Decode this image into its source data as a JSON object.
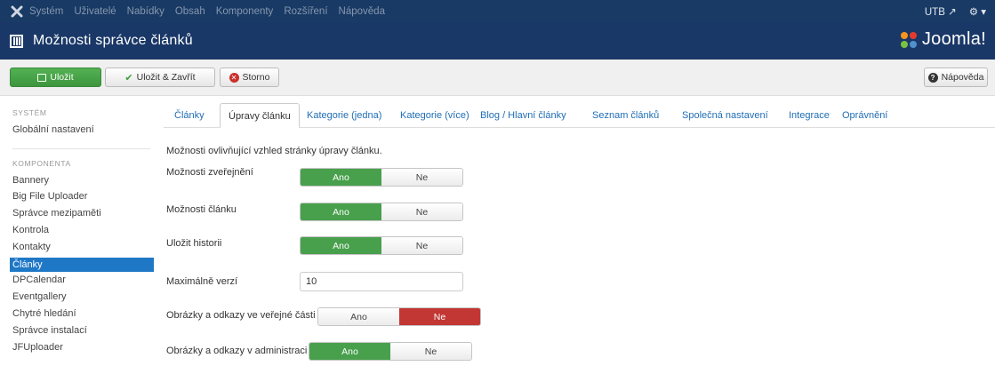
{
  "menubar": {
    "items": [
      "Systém",
      "Uživatelé",
      "Nabídky",
      "Obsah",
      "Komponenty",
      "Rozšíření",
      "Nápověda"
    ],
    "site_label": "UTB",
    "external_icon": "external-link-icon",
    "settings_icon": "gear-icon"
  },
  "header": {
    "title": "Možnosti správce článků",
    "brand": "Joomla!"
  },
  "toolbar": {
    "save_label": "Uložit",
    "save_close_label": "Uložit & Zavřít",
    "cancel_label": "Storno",
    "help_label": "Nápověda"
  },
  "sidebar": {
    "system_heading": "SYSTÉM",
    "system_items": [
      "Globální nastavení"
    ],
    "component_heading": "KOMPONENTA",
    "component_items": [
      "Bannery",
      "Big File Uploader",
      "Správce mezipaměti",
      "Kontrola",
      "Kontakty",
      "Články",
      "DPCalendar",
      "Eventgallery",
      "Chytré hledání",
      "Správce instalací",
      "JFUploader"
    ],
    "active_item": "Články"
  },
  "tabs": [
    {
      "label": "Články",
      "active": false
    },
    {
      "label": "Úpravy článku",
      "active": true
    },
    {
      "label": "Kategorie (jedna)",
      "active": false
    },
    {
      "label": "Kategorie (více)",
      "active": false
    },
    {
      "label": "Blog / Hlavní články",
      "active": false
    },
    {
      "label": "Seznam článků",
      "active": false
    },
    {
      "label": "Společná nastavení",
      "active": false
    },
    {
      "label": "Integrace",
      "active": false
    },
    {
      "label": "Oprávnění",
      "active": false
    }
  ],
  "form": {
    "description": "Možnosti ovlivňující vzhled stránky úpravy článku.",
    "yes_label": "Ano",
    "no_label": "Ne",
    "fields": [
      {
        "label": "Možnosti zveřejnění",
        "value": "Ano"
      },
      {
        "label": "Možnosti článku",
        "value": "Ano"
      },
      {
        "label": "Uložit historii",
        "value": "Ano"
      },
      {
        "label": "Maximálně verzí",
        "value": "10"
      },
      {
        "label": "Obrázky a odkazy ve veřejné části",
        "value": "Ne"
      },
      {
        "label": "Obrázky a odkazy v administraci",
        "value": "Ano"
      }
    ]
  },
  "colors": {
    "menubar_bg": "#183a65",
    "header_bg": "#1a3867",
    "active_yes": "#48a04c",
    "active_no": "#c23633",
    "sidebar_active": "#1f78c6",
    "link": "#1f6db5"
  }
}
